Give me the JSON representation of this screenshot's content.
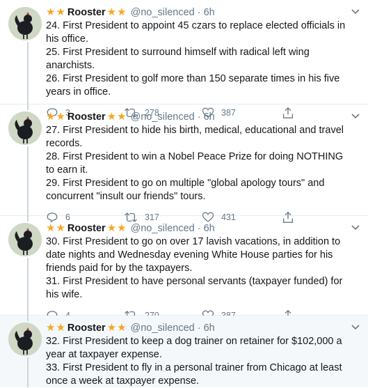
{
  "tweets": [
    {
      "name": "Rooster",
      "handle": "@no_silenced",
      "time": "6h",
      "lines": [
        "24. First President to appoint 45 czars to replace elected officials in his office.",
        "25. First President to surround himself with radical left wing anarchists.",
        "26. First President to golf more than 150 separate times in his five years in office."
      ],
      "replies": "3",
      "retweets": "278",
      "likes": "387"
    },
    {
      "name": "Rooster",
      "handle": "@no_silenced",
      "time": "6h",
      "lines": [
        "27. First President to hide his birth, medical, educational and travel records.",
        "28. First President to win a Nobel Peace Prize for doing NOTHING to earn it.",
        "29. First President to go on multiple \"global apology tours\" and concurrent \"insult our friends\" tours."
      ],
      "replies": "6",
      "retweets": "317",
      "likes": "431"
    },
    {
      "name": "Rooster",
      "handle": "@no_silenced",
      "time": "6h",
      "lines": [
        "30. First President to go on over 17 lavish vacations, in addition to date nights and Wednesday evening White House parties for his friends paid for by the taxpayers.",
        "31. First President to have personal servants (taxpayer funded) for his wife."
      ],
      "replies": "4",
      "retweets": "270",
      "likes": "387"
    },
    {
      "name": "Rooster",
      "handle": "@no_silenced",
      "time": "6h",
      "lines": [
        "32. First President to keep a dog trainer on retainer for $102,000 a year at taxpayer expense.",
        "33. First President to fly in a personal trainer from Chicago at least once a week at taxpayer expense."
      ]
    }
  ],
  "icons": {
    "star": "star-icon",
    "reply": "reply-icon",
    "retweet": "retweet-icon",
    "like": "heart-icon",
    "share": "share-icon",
    "more": "chevron-down-icon"
  },
  "colors": {
    "star": "#f5a623",
    "muted": "#657786",
    "thread_line": "#ccd6dd",
    "highlight_bg": "#f5f8fa"
  }
}
